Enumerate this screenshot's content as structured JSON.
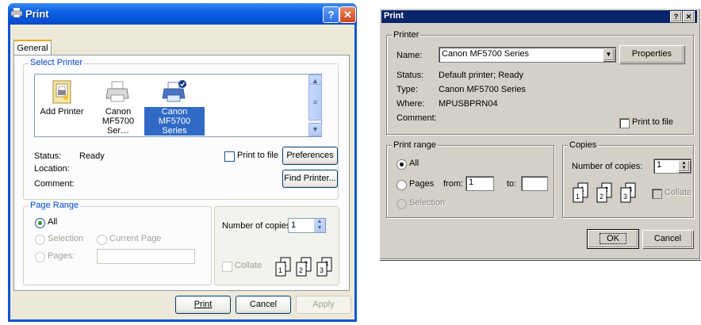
{
  "xp": {
    "title": "Print",
    "help_glyph": "?",
    "close_glyph": "✕",
    "tab": "General",
    "select_printer": {
      "label": "Select Printer",
      "printers": [
        {
          "label": "Add Printer",
          "icon": "add-printer-icon"
        },
        {
          "label": "Canon MF5700 Ser…",
          "icon": "printer-icon"
        },
        {
          "label": "Canon MF5700 Series",
          "icon": "default-printer-icon",
          "selected": true
        }
      ]
    },
    "status_label": "Status:",
    "status_value": "Ready",
    "location_label": "Location:",
    "comment_label": "Comment:",
    "print_to_file": "Print to file",
    "preferences": "Preferences",
    "find_printer": "Find Printer...",
    "page_range": {
      "label": "Page Range",
      "all": "All",
      "selection": "Selection",
      "current_page": "Current Page",
      "pages": "Pages:"
    },
    "copies_label": "Number of copies:",
    "copies_value": "1",
    "collate": "Collate",
    "print_button": "Print",
    "cancel_button": "Cancel",
    "apply_button": "Apply"
  },
  "classic": {
    "title": "Print",
    "help_glyph": "?",
    "close_glyph": "✕",
    "printer_group": "Printer",
    "name_label": "Name:",
    "name_value": "Canon MF5700 Series",
    "properties": "Properties",
    "status_label": "Status:",
    "status_value": "Default printer; Ready",
    "type_label": "Type:",
    "type_value": "Canon MF5700 Series",
    "where_label": "Where:",
    "where_value": "MPUSBPRN04",
    "comment_label": "Comment:",
    "print_to_file": "Print to file",
    "print_range_group": "Print range",
    "all": "All",
    "pages": "Pages",
    "from": "from:",
    "from_value": "1",
    "to": "to:",
    "selection": "Selection",
    "copies_group": "Copies",
    "copies_label": "Number of copies:",
    "copies_value": "1",
    "collate": "Collate",
    "ok": "OK",
    "cancel": "Cancel"
  },
  "colors": {
    "xp_title": "#0a5fe0",
    "xp_face": "#ece9d8",
    "classic_face": "#d4d0c8",
    "classic_title": "#0a246a"
  }
}
